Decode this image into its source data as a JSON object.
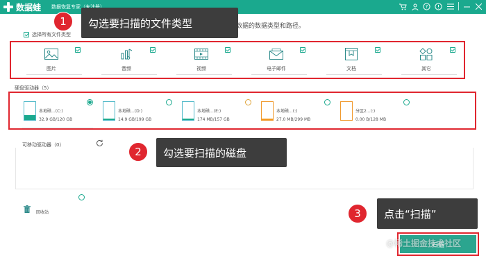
{
  "app": {
    "name": "数据蛙",
    "subtitle": "数据恢复专家（未注册）"
  },
  "header": {
    "description_tail": "恢复数据的数据类型和路径。"
  },
  "file_types": {
    "select_all_label": "选择所有文件类型",
    "items": [
      {
        "label": "图片",
        "icon": "image-icon",
        "checked": true
      },
      {
        "label": "音频",
        "icon": "audio-icon",
        "checked": true
      },
      {
        "label": "视频",
        "icon": "video-icon",
        "checked": true
      },
      {
        "label": "电子邮件",
        "icon": "email-icon",
        "checked": true
      },
      {
        "label": "文档",
        "icon": "document-icon",
        "checked": true
      },
      {
        "label": "其它",
        "icon": "other-icon",
        "checked": true
      }
    ]
  },
  "hard_drives": {
    "title": "硬盘驱动器（5）",
    "items": [
      {
        "name": "本地磁...(C:)",
        "size": "32.9 GB/120 GB",
        "selected": true,
        "usage": 0.27
      },
      {
        "name": "本地磁...(D:)",
        "size": "14.9 GB/199 GB",
        "selected": false,
        "usage": 0.07
      },
      {
        "name": "本地磁...(E:)",
        "size": "174 MB/157 GB",
        "selected": false,
        "usage": 0.01
      },
      {
        "name": "本地磁...(:)",
        "size": "27.0 MB/299 MB",
        "selected": false,
        "usage": 0.09
      },
      {
        "name": "分区2...(:)",
        "size": "0.00  B/128 MB",
        "selected": false,
        "usage": 0.0
      }
    ]
  },
  "removable": {
    "title": "可移动驱动器（0）"
  },
  "recycle_bin": {
    "label": "回收站"
  },
  "scan_button": {
    "label": "扫描"
  },
  "watermark": "@稀土掘金技术社区",
  "callouts": [
    {
      "number": "1",
      "text": "勾选要扫描的文件类型"
    },
    {
      "number": "2",
      "text": "勾选要扫描的磁盘"
    },
    {
      "number": "3",
      "text": "点击“扫描”"
    }
  ],
  "colors": {
    "brand": "#1aa98e",
    "highlight": "#e0262f",
    "callout_bg": "#3d3d3d"
  }
}
